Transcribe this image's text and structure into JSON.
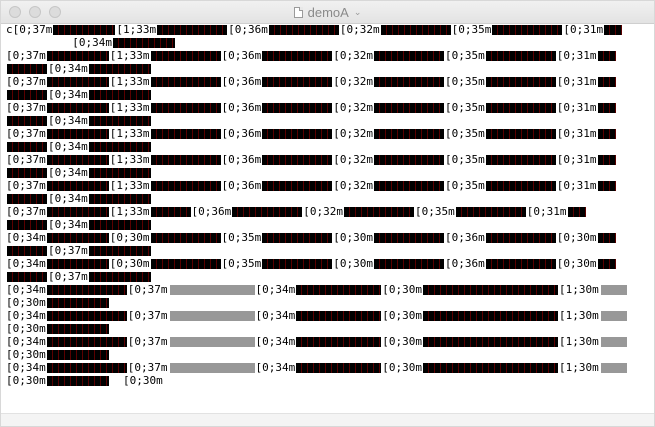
{
  "window": {
    "title": "demoA",
    "chevron": "chevron-down-icon"
  },
  "terminal": {
    "lines": [
      {
        "segments": [
          {
            "code": "c[0;37m",
            "w": 62
          },
          {
            "code": "[1;33m",
            "w": 70
          },
          {
            "code": "[0;36m",
            "w": 70
          },
          {
            "code": "[0;32m",
            "w": 70
          },
          {
            "code": "[0;35m",
            "w": 70
          },
          {
            "code": "[0;31m",
            "w": 18
          }
        ]
      },
      {
        "segments": [
          {
            "code": "          [0;34m",
            "w": 62
          }
        ]
      },
      {
        "segments": [
          {
            "code": "[0;37m",
            "w": 62
          },
          {
            "code": "[1;33m",
            "w": 70
          },
          {
            "code": "[0;36m",
            "w": 70
          },
          {
            "code": "[0;32m",
            "w": 70
          },
          {
            "code": "[0;35m",
            "w": 70
          },
          {
            "code": "[0;31m",
            "w": 18
          }
        ]
      },
      {
        "segments": [
          {
            "code": "",
            "w": 40
          },
          {
            "code": "[0;34m",
            "w": 62
          }
        ]
      },
      {
        "segments": [
          {
            "code": "[0;37m",
            "w": 62
          },
          {
            "code": "[1;33m",
            "w": 70
          },
          {
            "code": "[0;36m",
            "w": 70
          },
          {
            "code": "[0;32m",
            "w": 70
          },
          {
            "code": "[0;35m",
            "w": 70
          },
          {
            "code": "[0;31m",
            "w": 18
          }
        ]
      },
      {
        "segments": [
          {
            "code": "",
            "w": 40
          },
          {
            "code": "[0;34m",
            "w": 62
          }
        ]
      },
      {
        "segments": [
          {
            "code": "[0;37m",
            "w": 62
          },
          {
            "code": "[1;33m",
            "w": 70
          },
          {
            "code": "[0;36m",
            "w": 70
          },
          {
            "code": "[0;32m",
            "w": 70
          },
          {
            "code": "[0;35m",
            "w": 70
          },
          {
            "code": "[0;31m",
            "w": 18
          }
        ]
      },
      {
        "segments": [
          {
            "code": "",
            "w": 40
          },
          {
            "code": "[0;34m",
            "w": 62
          }
        ]
      },
      {
        "segments": [
          {
            "code": "[0;37m",
            "w": 62
          },
          {
            "code": "[1;33m",
            "w": 70
          },
          {
            "code": "[0;36m",
            "w": 70
          },
          {
            "code": "[0;32m",
            "w": 70
          },
          {
            "code": "[0;35m",
            "w": 70
          },
          {
            "code": "[0;31m",
            "w": 18
          }
        ]
      },
      {
        "segments": [
          {
            "code": "",
            "w": 40
          },
          {
            "code": "[0;34m",
            "w": 62
          }
        ]
      },
      {
        "segments": [
          {
            "code": "[0;37m",
            "w": 62
          },
          {
            "code": "[1;33m",
            "w": 70
          },
          {
            "code": "[0;36m",
            "w": 70
          },
          {
            "code": "[0;32m",
            "w": 70
          },
          {
            "code": "[0;35m",
            "w": 70
          },
          {
            "code": "[0;31m",
            "w": 18
          }
        ]
      },
      {
        "segments": [
          {
            "code": "",
            "w": 40
          },
          {
            "code": "[0;34m",
            "w": 62
          }
        ]
      },
      {
        "segments": [
          {
            "code": "[0;37m",
            "w": 62
          },
          {
            "code": "[1;33m",
            "w": 70
          },
          {
            "code": "[0;36m",
            "w": 70
          },
          {
            "code": "[0;32m",
            "w": 70
          },
          {
            "code": "[0;35m",
            "w": 70
          },
          {
            "code": "[0;31m",
            "w": 18
          }
        ]
      },
      {
        "segments": [
          {
            "code": "",
            "w": 40
          },
          {
            "code": "[0;34m",
            "w": 62
          }
        ]
      },
      {
        "segments": [
          {
            "code": "[0;37m",
            "w": 62
          },
          {
            "code": "[1;33m",
            "w": 40
          },
          {
            "code": "[0;36m",
            "w": 70
          },
          {
            "code": "[0;32m",
            "w": 70
          },
          {
            "code": "[0;35m",
            "w": 70
          },
          {
            "code": "[0;31m",
            "w": 18
          }
        ]
      },
      {
        "segments": [
          {
            "code": "",
            "w": 40
          },
          {
            "code": "[0;34m",
            "w": 62
          }
        ]
      },
      {
        "segments": [
          {
            "code": "[0;34m",
            "w": 62
          },
          {
            "code": "[0;30m",
            "w": 70
          },
          {
            "code": "[0;35m",
            "w": 70
          },
          {
            "code": "[0;30m",
            "w": 70
          },
          {
            "code": "[0;36m",
            "w": 70
          },
          {
            "code": "[0;30m",
            "w": 18
          }
        ]
      },
      {
        "segments": [
          {
            "code": "",
            "w": 40
          },
          {
            "code": "[0;37m",
            "w": 62
          }
        ]
      },
      {
        "segments": [
          {
            "code": "[0;34m",
            "w": 62
          },
          {
            "code": "[0;30m",
            "w": 70
          },
          {
            "code": "[0;35m",
            "w": 70
          },
          {
            "code": "[0;30m",
            "w": 70
          },
          {
            "code": "[0;36m",
            "w": 70
          },
          {
            "code": "[0;30m",
            "w": 18
          }
        ]
      },
      {
        "segments": [
          {
            "code": "",
            "w": 40
          },
          {
            "code": "[0;37m",
            "w": 62
          }
        ]
      },
      {
        "segments": [
          {
            "code": "[0;34m",
            "w": 80
          },
          {
            "code": "[0;37m",
            "w": 85,
            "dot": true
          },
          {
            "code": "[0;34m",
            "w": 85
          },
          {
            "code": "[0;30m",
            "w": 135
          },
          {
            "code": "[1;30m",
            "w": 26,
            "dot": true
          }
        ]
      },
      {
        "segments": [
          {
            "code": "[0;30m",
            "w": 62
          }
        ]
      },
      {
        "segments": [
          {
            "code": "[0;34m",
            "w": 80
          },
          {
            "code": "[0;37m",
            "w": 85,
            "dot": true
          },
          {
            "code": "[0;34m",
            "w": 85
          },
          {
            "code": "[0;30m",
            "w": 135
          },
          {
            "code": "[1;30m",
            "w": 26,
            "dot": true
          }
        ]
      },
      {
        "segments": [
          {
            "code": "[0;30m",
            "w": 62
          }
        ]
      },
      {
        "segments": [
          {
            "code": "[0;34m",
            "w": 80
          },
          {
            "code": "[0;37m",
            "w": 85,
            "dot": true
          },
          {
            "code": "[0;34m",
            "w": 85
          },
          {
            "code": "[0;30m",
            "w": 135
          },
          {
            "code": "[1;30m",
            "w": 26,
            "dot": true
          }
        ]
      },
      {
        "segments": [
          {
            "code": "[0;30m",
            "w": 62
          }
        ]
      },
      {
        "segments": [
          {
            "code": "[0;34m",
            "w": 80
          },
          {
            "code": "[0;37m",
            "w": 85,
            "dot": true
          },
          {
            "code": "[0;34m",
            "w": 85
          },
          {
            "code": "[0;30m",
            "w": 135
          },
          {
            "code": "[1;30m",
            "w": 26,
            "dot": true
          }
        ]
      },
      {
        "segments": [
          {
            "code": "[0;30m",
            "w": 62
          },
          {
            "code": "  [0;30m",
            "w": 0
          }
        ]
      }
    ]
  }
}
